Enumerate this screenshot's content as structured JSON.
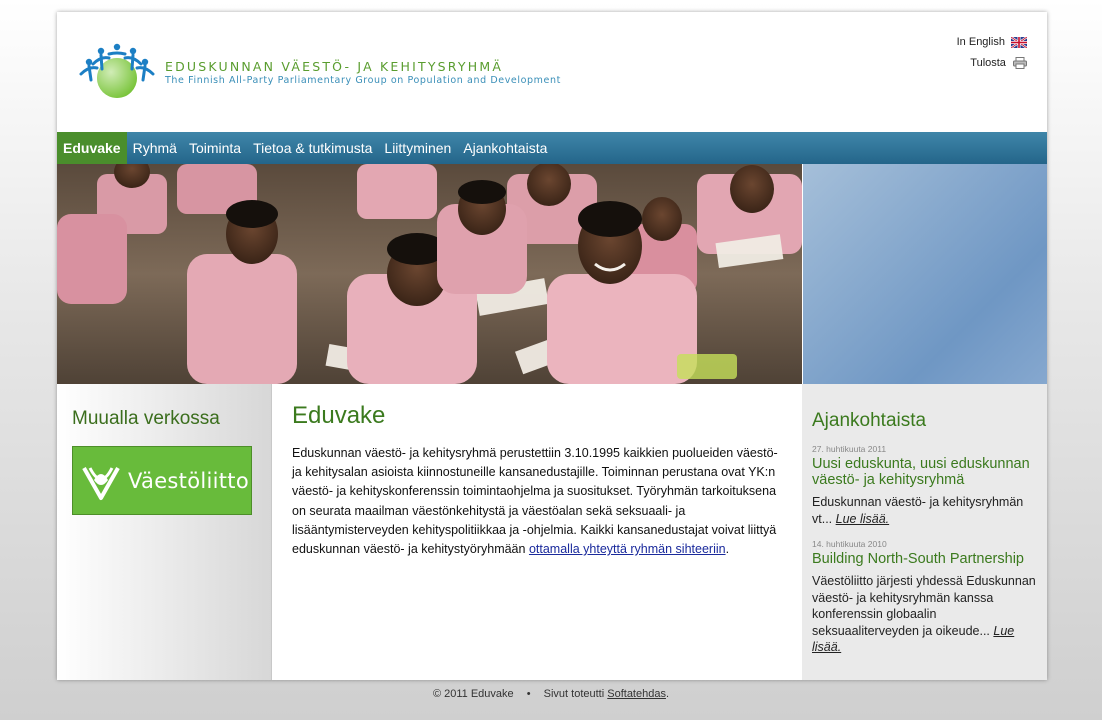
{
  "header": {
    "title": "EDUSKUNNAN VÄESTÖ- JA KEHITYSRYHMÄ",
    "subtitle": "The Finnish All-Party Parliamentary Group on Population and Development",
    "language_link": "In English",
    "print_link": "Tulosta"
  },
  "nav": {
    "items": [
      "Eduvake",
      "Ryhmä",
      "Toiminta",
      "Tietoa & tutkimusta",
      "Liittyminen",
      "Ajankohtaista"
    ],
    "active": "Eduvake"
  },
  "left": {
    "heading": "Muualla verkossa",
    "banner_label": "Väestöliitto"
  },
  "main": {
    "heading": "Eduvake",
    "text": "Eduskunnan väestö- ja kehitysryhmä perustettiin 3.10.1995 kaikkien puolueiden väestö- ja kehitysalan asioista kiinnostuneille kansanedustajille. Toiminnan perustana ovat YK:n väestö- ja kehityskonferenssin toimintaohjelma ja suositukset. Työryhmän tarkoituksena on seurata maailman väestönkehitystä ja väestöalan sekä seksuaali- ja lisääntymisterveyden kehityspolitiikkaa ja -ohjelmia. Kaikki kansanedustajat voivat liittyä eduskunnan väestö- ja kehitystyöryhmään ",
    "link": "ottamalla yhteyttä ryhmän sihteeriin",
    "tail": "."
  },
  "right": {
    "heading": "Ajankohtaista",
    "news": [
      {
        "date": "27. huhtikuuta 2011",
        "title": "Uusi eduskunta, uusi eduskunnan väestö- ja kehitysryhmä",
        "body": "Eduskunnan väestö- ja kehitysryhmän vt... ",
        "more": "Lue lisää."
      },
      {
        "date": "14. huhtikuuta 2010",
        "title": "Building North-South Partnership",
        "body": "Väestöliitto järjesti yhdessä Eduskunnan väestö- ja kehitysryhmän kanssa konferenssin globaalin seksuaaliterveyden ja oikeude... ",
        "more": "Lue lisää."
      }
    ]
  },
  "footer": {
    "copyright": "© 2011 Eduvake",
    "separator": "•",
    "credit": "Sivut toteutti",
    "credit_link": "Softatehdas",
    "credit_tail": "."
  },
  "colors": {
    "brand_green": "#5a9d2f",
    "nav_blue": "#2e7499",
    "nav_active": "#4a8e2c",
    "heading_green": "#3b7a1e"
  },
  "icons": [
    "people-circle-logo-icon",
    "uk-flag-icon",
    "printer-icon",
    "vaestoliitto-logo-icon"
  ]
}
